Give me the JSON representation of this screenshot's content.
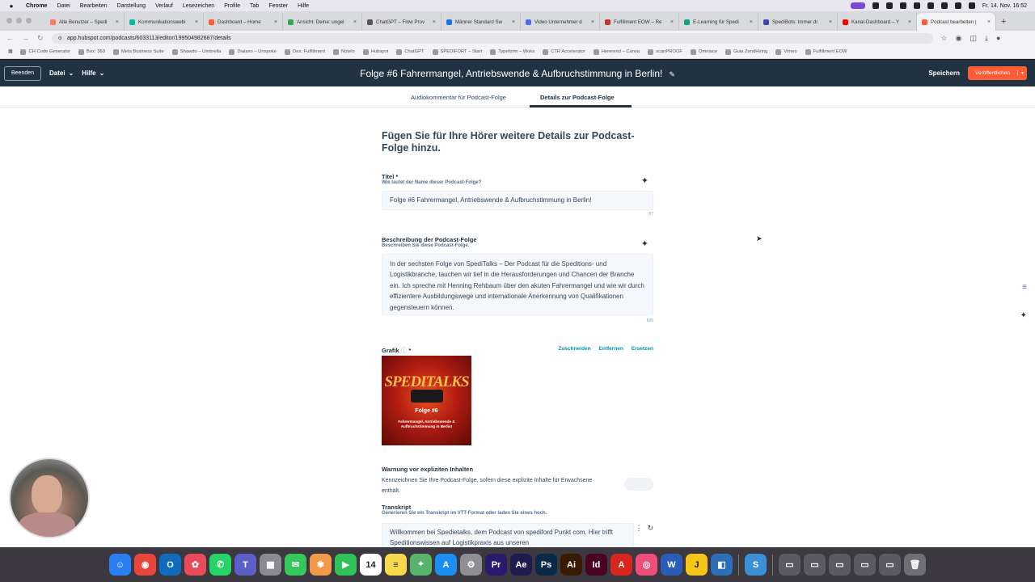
{
  "menubar": {
    "app": "Chrome",
    "items": [
      "Datei",
      "Bearbeiten",
      "Darstellung",
      "Verlauf",
      "Lesezeichen",
      "Profile",
      "Tab",
      "Fenster",
      "Hilfe"
    ],
    "clock": "Fr. 14. Nov. 16:52"
  },
  "tabs": [
    {
      "label": "Alle Benutzer – Spedi",
      "color": "#ff7a59"
    },
    {
      "label": "Kommunikationswebi",
      "color": "#00bda5"
    },
    {
      "label": "Dashboard – Home",
      "color": "#ff5c35"
    },
    {
      "label": "Ansicht: Deine::ungel",
      "color": "#34a853"
    },
    {
      "label": "ChatGPT – Flow Prov",
      "color": "#555555"
    },
    {
      "label": "Männer Standard Sw",
      "color": "#1a73e8"
    },
    {
      "label": "Video Unternehmer d",
      "color": "#4a6cf7"
    },
    {
      "label": "Fulfillment EOW – Re",
      "color": "#c0392b"
    },
    {
      "label": "E-Learning für Spedi",
      "color": "#16a085"
    },
    {
      "label": "SpediBots: Immer dr",
      "color": "#3949ab"
    },
    {
      "label": "Kanal-Dashboard – Y",
      "color": "#ff0000"
    },
    {
      "label": "Podcast bearbeiten |",
      "color": "#ff5c35"
    }
  ],
  "address": {
    "url": "app.hubspot.com/podcasts/6033113/editor/199504982687/details"
  },
  "bookmarks": [
    "CH Code Generator",
    "Box: 360",
    "Meta Business Suite",
    "Shawdo – Umbrella",
    "Dialaxo – Unspoke",
    "Des: Fulfillment",
    "Notelo",
    "Hubspot",
    "ChatGPT",
    "SPEDIFORT – Start",
    "Typeform – Woks",
    "CTR Accelerator",
    "Hererend – Canva",
    "scanPROOF",
    "Omniace",
    "Guia ZendHiring",
    "Vimeo",
    "Fulfillment EOW"
  ],
  "hubspot": {
    "exit_label": "Beenden",
    "file_menu": "Datei",
    "help_menu": "Hilfe",
    "episode_title": "Folge #6 Fahrermangel, Antriebswende & Aufbruchstimmung in Berlin!",
    "save_label": "Speichern",
    "publish_label": "Veröffentlichen"
  },
  "subtabs": {
    "audio": "Audiokommentar für Podcast-Folge",
    "details": "Details zur Podcast-Folge"
  },
  "form": {
    "heading": "Fügen Sie für Ihre Hörer weitere Details zur Podcast-Folge hinzu.",
    "title_label": "Titel *",
    "title_help": "Wie lautet der Name dieser Podcast-Folge?",
    "title_value": "Folge #6 Fahrermangel, Antriebswende & Aufbruchstimmung in Berlin!",
    "title_count": "67",
    "desc_label": "Beschreibung der Podcast-Folge",
    "desc_help": "Beschreiben Sie diese Podcast-Folge.",
    "desc_value": "In der sechsten Folge von SpediTalks – Der Podcast für die Speditions- und Logistikbranche, tauchen wir tief in die Herausforderungen und Chancen der Branche ein. Ich spreche mit Henning Rehbaum über den akuten Fahrermangel und wie wir durch effizientere Ausbildungswege und internationale Anerkennung von Qualifikationen gegensteuern können.",
    "desc_count": "626",
    "image_label": "Grafik",
    "image_crop": "Zuschneiden",
    "image_remove": "Entfernen",
    "image_replace": "Ersetzen",
    "cover_brand": "SPEDITALKS",
    "cover_episode": "Folge #6",
    "cover_subtitle": "Fahrermangel, Antriebswende & Aufbruchstimmung in Berlin!",
    "explicit_label": "Warnung vor expliziten Inhalten",
    "explicit_text": "Kennzeichnen Sie Ihre Podcast-Folge, sofern diese explizite Inhalte für Erwachsene enthält.",
    "explicit_on": false,
    "transcript_label": "Transkript",
    "transcript_help": "Generieren Sie ein Transkript im VTT-Format oder laden Sie eines hoch.",
    "transcript_value": "Willkommen bei Spedietalks, dem Podcast von spediford Punkt com. Hier trifft Speditionswissen auf Logistikpraxis aus unseren"
  },
  "dock": [
    {
      "name": "finder",
      "color": "#2a7ff5",
      "glyph": "☺"
    },
    {
      "name": "chrome",
      "color": "#e8453c",
      "glyph": "◉"
    },
    {
      "name": "outlook",
      "color": "#0f6cbd",
      "glyph": "O"
    },
    {
      "name": "app",
      "color": "#e94b5a",
      "glyph": "✿"
    },
    {
      "name": "whatsapp",
      "color": "#25d366",
      "glyph": "✆"
    },
    {
      "name": "teams",
      "color": "#5b5fc7",
      "glyph": "T"
    },
    {
      "name": "launchpad",
      "color": "#8a8a93",
      "glyph": "▦"
    },
    {
      "name": "messages",
      "color": "#34c759",
      "glyph": "✉"
    },
    {
      "name": "photos",
      "color": "#f2994a",
      "glyph": "✾"
    },
    {
      "name": "facetime",
      "color": "#30c159",
      "glyph": "▶"
    },
    {
      "name": "calendar",
      "color": "#ffffff",
      "glyph": "14"
    },
    {
      "name": "notes",
      "color": "#f7d94c",
      "glyph": "≡"
    },
    {
      "name": "maps",
      "color": "#59b36b",
      "glyph": "⌖"
    },
    {
      "name": "appstore",
      "color": "#1b8ef2",
      "glyph": "A"
    },
    {
      "name": "settings",
      "color": "#8e8e93",
      "glyph": "⚙"
    },
    {
      "name": "premiere",
      "color": "#2a1a6e",
      "glyph": "Pr"
    },
    {
      "name": "aftereffects",
      "color": "#1f1b4e",
      "glyph": "Ae"
    },
    {
      "name": "photoshop",
      "color": "#0b2a4a",
      "glyph": "Ps"
    },
    {
      "name": "illustrator",
      "color": "#3a1a00",
      "glyph": "Ai"
    },
    {
      "name": "indesign",
      "color": "#49021f",
      "glyph": "Id"
    },
    {
      "name": "acrobat",
      "color": "#d7261e",
      "glyph": "A"
    },
    {
      "name": "app2",
      "color": "#f04e7a",
      "glyph": "◎"
    },
    {
      "name": "word",
      "color": "#2b5cb8",
      "glyph": "W"
    },
    {
      "name": "app3",
      "color": "#f5c518",
      "glyph": "J"
    },
    {
      "name": "app4",
      "color": "#2c6eb8",
      "glyph": "◧"
    },
    {
      "name": "app5",
      "color": "#3a8fd6",
      "glyph": "S"
    }
  ]
}
